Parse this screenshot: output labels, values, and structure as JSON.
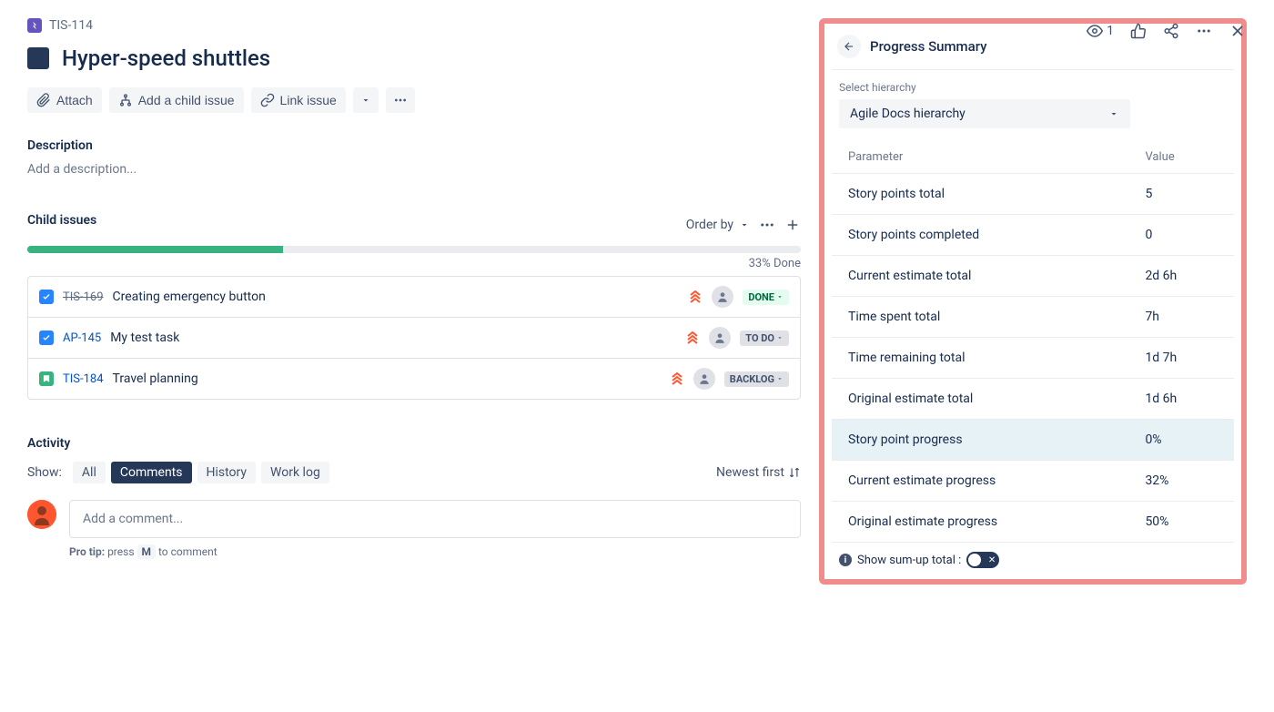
{
  "breadcrumb": {
    "key": "TIS-114"
  },
  "title": "Hyper-speed shuttles",
  "toolbar": {
    "attach": "Attach",
    "add_child": "Add a child issue",
    "link": "Link issue"
  },
  "description": {
    "label": "Description",
    "placeholder": "Add a description..."
  },
  "child_issues": {
    "label": "Child issues",
    "order_by": "Order by",
    "progress_pct": 33,
    "progress_text": "33% Done",
    "items": [
      {
        "key": "TIS-169",
        "summary": "Creating emergency button",
        "status": "DONE",
        "status_style": "done",
        "type": "task",
        "key_style": "done"
      },
      {
        "key": "AP-145",
        "summary": "My test task",
        "status": "TO DO",
        "status_style": "todo",
        "type": "task",
        "key_style": ""
      },
      {
        "key": "TIS-184",
        "summary": "Travel planning",
        "status": "BACKLOG",
        "status_style": "backlog",
        "type": "story",
        "key_style": ""
      }
    ]
  },
  "activity": {
    "label": "Activity",
    "show": "Show:",
    "tabs": {
      "all": "All",
      "comments": "Comments",
      "history": "History",
      "worklog": "Work log"
    },
    "newest": "Newest first",
    "comment_placeholder": "Add a comment...",
    "pro_tip_prefix": "Pro tip:",
    "pro_tip_press": "press",
    "pro_tip_key": "M",
    "pro_tip_suffix": "to comment"
  },
  "header_actions": {
    "watch_count": "1"
  },
  "side_panel": {
    "title": "Progress Summary",
    "hierarchy_label": "Select hierarchy",
    "hierarchy_value": "Agile Docs hierarchy",
    "columns": {
      "parameter": "Parameter",
      "value": "Value"
    },
    "rows": [
      {
        "parameter": "Story points total",
        "value": "5",
        "highlight": false
      },
      {
        "parameter": "Story points completed",
        "value": "0",
        "highlight": false
      },
      {
        "parameter": "Current estimate total",
        "value": "2d 6h",
        "highlight": false
      },
      {
        "parameter": "Time spent total",
        "value": "7h",
        "highlight": false
      },
      {
        "parameter": "Time remaining total",
        "value": "1d 7h",
        "highlight": false
      },
      {
        "parameter": "Original estimate total",
        "value": "1d 6h",
        "highlight": false
      },
      {
        "parameter": "Story point progress",
        "value": "0%",
        "highlight": true
      },
      {
        "parameter": "Current estimate progress",
        "value": "32%",
        "highlight": false
      },
      {
        "parameter": "Original estimate progress",
        "value": "50%",
        "highlight": false
      }
    ],
    "sumup_label": "Show sum-up total :"
  }
}
